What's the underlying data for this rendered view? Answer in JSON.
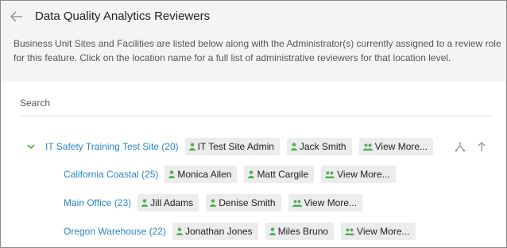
{
  "header": {
    "title": "Data Quality Analytics Reviewers",
    "description": "Business Unit Sites and Facilities are listed below along with the Administrator(s) currently assigned to a review role for this feature. Click on the location name for a full list of administrative reviewers for that location level."
  },
  "search": {
    "placeholder": "Search"
  },
  "locations": [
    {
      "name": "IT Safety Training Test Site (20)",
      "chips": [
        "IT Test Site Admin",
        "Jack Smith",
        "View More..."
      ]
    },
    {
      "name": "California Coastal (25)",
      "chips": [
        "Monica Allen",
        "Matt Cargile",
        "View More..."
      ]
    },
    {
      "name": "Main Office (23)",
      "chips": [
        "Jill Adams",
        "Denise Smith",
        "View More..."
      ]
    },
    {
      "name": "Oregon Warehouse (22)",
      "chips": [
        "Jonathan Jones",
        "Miles Bruno",
        "View More..."
      ]
    }
  ],
  "icons": {
    "back": "arrow-left-icon",
    "expand": "chevron-down-icon",
    "person": "person-icon",
    "group": "people-icon",
    "collapse_all": "collapse-all-icon",
    "expand_all": "expand-all-icon"
  },
  "colors": {
    "link": "#2a85c9",
    "icon_green": "#4caf50",
    "chip_bg": "#ececec",
    "header_bg": "#f4f4f4"
  }
}
